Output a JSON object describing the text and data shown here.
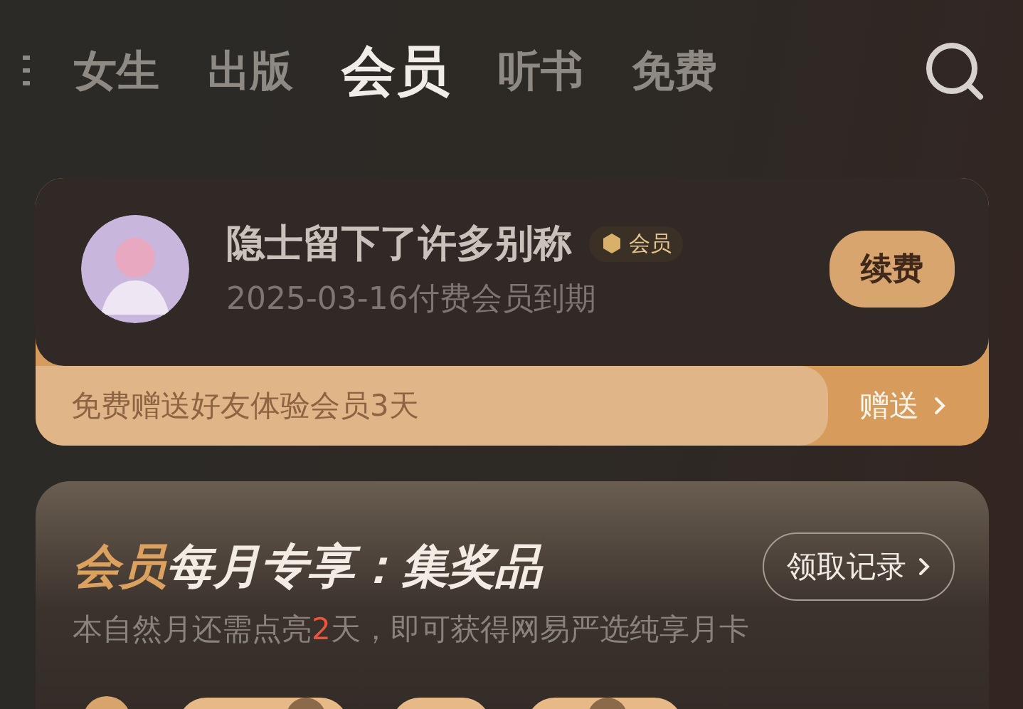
{
  "top_nav": {
    "tabs": [
      {
        "label": "女生",
        "selected": false
      },
      {
        "label": "出版",
        "selected": false
      },
      {
        "label": "会员",
        "selected": true
      },
      {
        "label": "听书",
        "selected": false
      },
      {
        "label": "免费",
        "selected": false
      }
    ]
  },
  "member_card": {
    "name": "隐士留下了许多别称",
    "badge": "会员",
    "expiry": "2025-03-16付费会员到期",
    "renew_button": "续费",
    "gift_banner": {
      "text": "免费赠送好友体验会员3天",
      "button": "赠送"
    }
  },
  "monthly_card": {
    "title_highlight": "会员",
    "title": "每月专享：集奖品",
    "records_button": "领取记录",
    "subtitle": {
      "before": "本自然月还需点亮",
      "count": "2",
      "after": "天，即可获得网易严选纯享月卡"
    }
  }
}
